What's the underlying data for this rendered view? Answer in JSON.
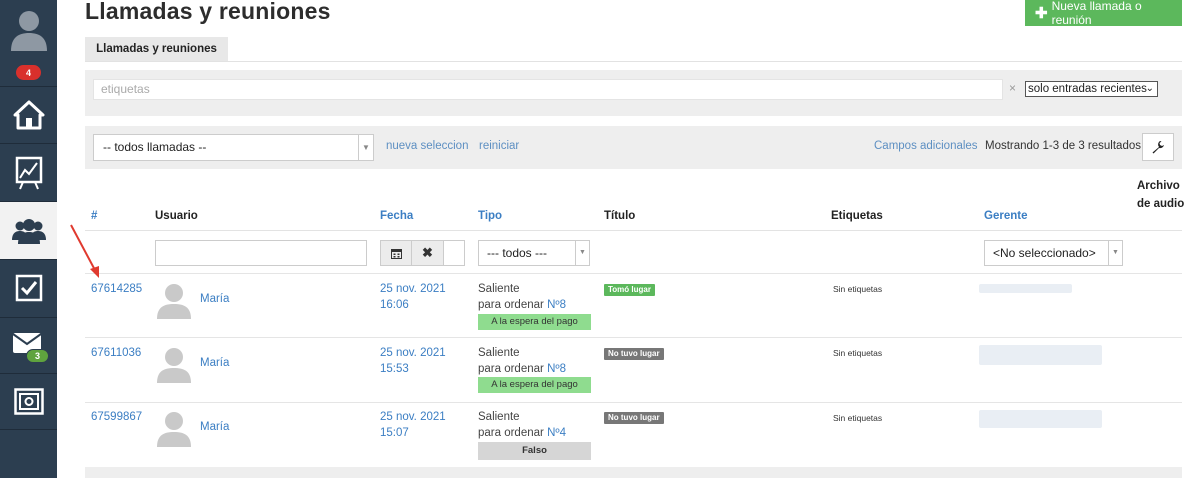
{
  "sidebar": {
    "notif_badge": "4",
    "mail_badge": "3",
    "items": [
      {
        "icon": "user-avatar-icon"
      },
      {
        "icon": "home-icon"
      },
      {
        "icon": "chart-board-icon"
      },
      {
        "icon": "users-group-icon"
      },
      {
        "icon": "checkbox-icon"
      },
      {
        "icon": "mail-icon"
      },
      {
        "icon": "safe-icon"
      }
    ]
  },
  "header": {
    "title": "Llamadas y reuniones",
    "new_button": "Nueva llamada o reunión",
    "tab": "Llamadas y reuniones"
  },
  "filters": {
    "tags_placeholder": "etiquetas",
    "clear": "×",
    "recent_select": "solo entradas recientes",
    "calls_select": "-- todos llamadas --",
    "new_selection": "nueva seleccion",
    "reset": "reiniciar",
    "extra_fields": "Campos adicionales",
    "showing": "Mostrando 1-3 de 3 resultados."
  },
  "table": {
    "headers": {
      "id": "#",
      "user": "Usuario",
      "date": "Fecha",
      "type": "Tipo",
      "title": "Título",
      "tags": "Etiquetas",
      "manager": "Gerente",
      "audio": "Archivo de audio"
    },
    "type_filter": "--- todos ---",
    "manager_filter": "<No seleccionado>",
    "rows": [
      {
        "id": "67614285",
        "user": "María",
        "date": "25 nov. 2021",
        "time": "16:06",
        "type": "Saliente",
        "order_prefix": "para ordenar",
        "order": "Nº8",
        "payment": "A la espera del pago",
        "status": "Tomó lugar",
        "tags": "Sin etiquetas"
      },
      {
        "id": "67611036",
        "user": "María",
        "date": "25 nov. 2021",
        "time": "15:53",
        "type": "Saliente",
        "order_prefix": "para ordenar",
        "order": "Nº8",
        "payment": "A la espera del pago",
        "status": "No tuvo lugar",
        "tags": "Sin etiquetas"
      },
      {
        "id": "67599867",
        "user": "María",
        "date": "25 nov. 2021",
        "time": "15:07",
        "type": "Saliente",
        "order_prefix": "para ordenar",
        "order": "Nº4",
        "payment": "Falso",
        "status": "No tuvo lugar",
        "tags": "Sin etiquetas"
      }
    ]
  },
  "colors": {
    "sidebar": "#2c3e50",
    "accent_green": "#5cb85c",
    "link_blue": "#3b7ec3",
    "status_done": "#5cb85c",
    "status_not_done": "#777777",
    "payment_waiting": "#8fdc8f",
    "payment_false": "#d6d6d6",
    "arrow": "#e03a2f"
  }
}
